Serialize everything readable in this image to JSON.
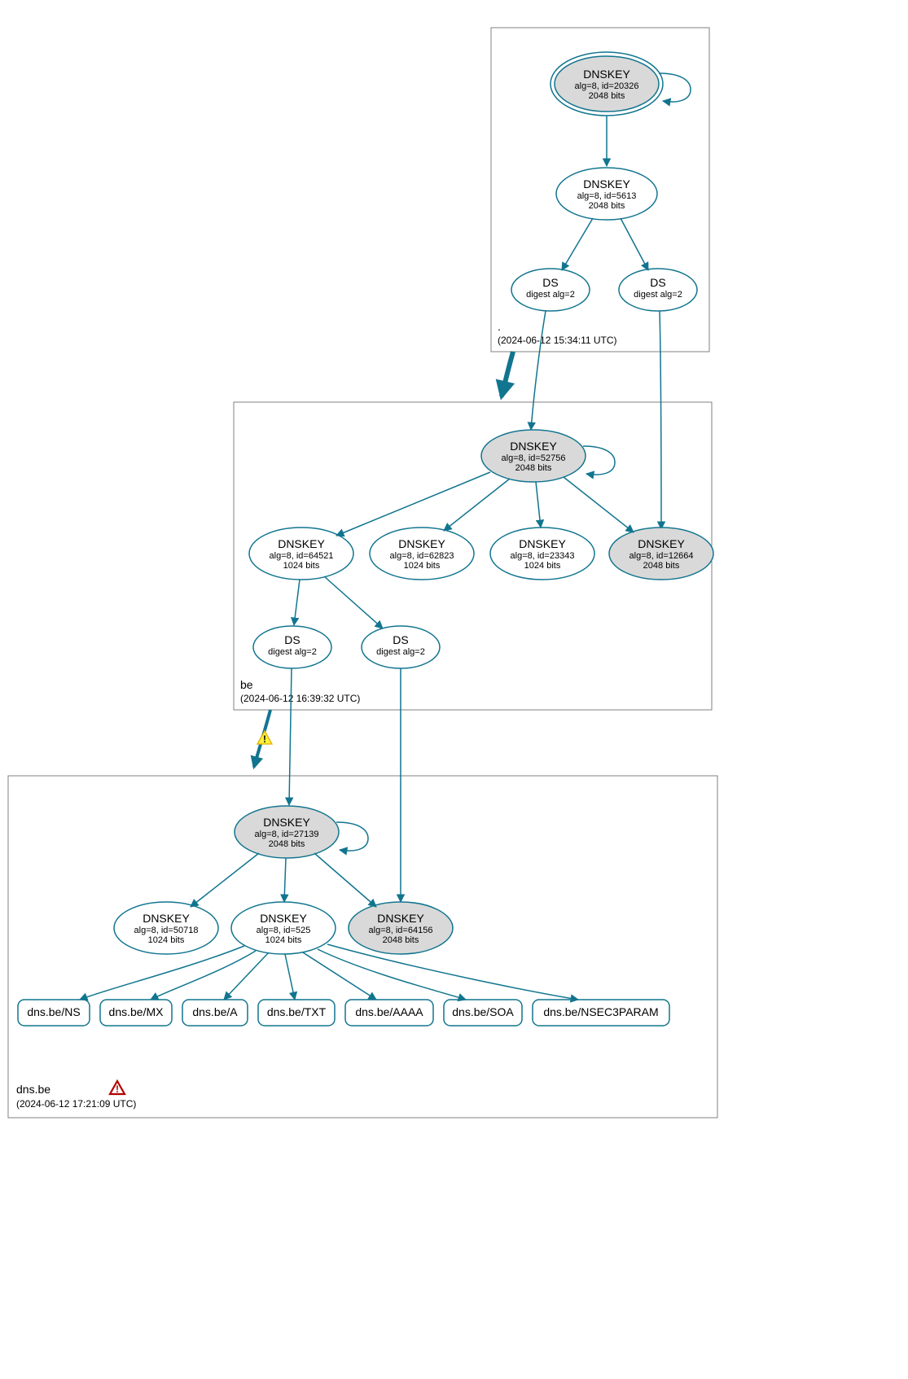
{
  "chart_data": {
    "type": "graph",
    "zones": [
      {
        "id": "root",
        "label": ".",
        "timestamp": "(2024-06-12 15:34:11 UTC)",
        "nodes": [
          {
            "id": "root-ksk",
            "type": "DNSKEY",
            "alg": 8,
            "keyid": 20326,
            "bits": 2048,
            "sep": true,
            "double_ring": true,
            "self_loop": true
          },
          {
            "id": "root-zsk",
            "type": "DNSKEY",
            "alg": 8,
            "keyid": 5613,
            "bits": 2048,
            "sep": false
          },
          {
            "id": "root-ds1",
            "type": "DS",
            "digest_alg": 2
          },
          {
            "id": "root-ds2",
            "type": "DS",
            "digest_alg": 2
          }
        ]
      },
      {
        "id": "be",
        "label": "be",
        "timestamp": "(2024-06-12 16:39:32 UTC)",
        "nodes": [
          {
            "id": "be-ksk",
            "type": "DNSKEY",
            "alg": 8,
            "keyid": 52756,
            "bits": 2048,
            "sep": true,
            "self_loop": true
          },
          {
            "id": "be-zsk1",
            "type": "DNSKEY",
            "alg": 8,
            "keyid": 64521,
            "bits": 1024,
            "sep": false
          },
          {
            "id": "be-zsk2",
            "type": "DNSKEY",
            "alg": 8,
            "keyid": 62823,
            "bits": 1024,
            "sep": false
          },
          {
            "id": "be-zsk3",
            "type": "DNSKEY",
            "alg": 8,
            "keyid": 23343,
            "bits": 1024,
            "sep": false
          },
          {
            "id": "be-key4",
            "type": "DNSKEY",
            "alg": 8,
            "keyid": 12664,
            "bits": 2048,
            "sep": true
          },
          {
            "id": "be-ds1",
            "type": "DS",
            "digest_alg": 2
          },
          {
            "id": "be-ds2",
            "type": "DS",
            "digest_alg": 2
          }
        ]
      },
      {
        "id": "dns.be",
        "label": "dns.be",
        "timestamp": "(2024-06-12 17:21:09 UTC)",
        "has_error_icon": true,
        "nodes": [
          {
            "id": "dnsbe-ksk",
            "type": "DNSKEY",
            "alg": 8,
            "keyid": 27139,
            "bits": 2048,
            "sep": true,
            "self_loop": true
          },
          {
            "id": "dnsbe-zsk1",
            "type": "DNSKEY",
            "alg": 8,
            "keyid": 50718,
            "bits": 1024,
            "sep": false
          },
          {
            "id": "dnsbe-zsk2",
            "type": "DNSKEY",
            "alg": 8,
            "keyid": 525,
            "bits": 1024,
            "sep": false
          },
          {
            "id": "dnsbe-key3",
            "type": "DNSKEY",
            "alg": 8,
            "keyid": 64156,
            "bits": 2048,
            "sep": true
          }
        ],
        "rrsets": [
          "dns.be/NS",
          "dns.be/MX",
          "dns.be/A",
          "dns.be/TXT",
          "dns.be/AAAA",
          "dns.be/SOA",
          "dns.be/NSEC3PARAM"
        ]
      }
    ],
    "edges": [
      {
        "from": "root-ksk",
        "to": "root-zsk"
      },
      {
        "from": "root-zsk",
        "to": "root-ds1"
      },
      {
        "from": "root-zsk",
        "to": "root-ds2"
      },
      {
        "from": "root-ds1",
        "to": "be-ksk"
      },
      {
        "from": "root-ds2",
        "to": "be-key4"
      },
      {
        "from": "root",
        "to": "be",
        "delegation": true,
        "thick": true
      },
      {
        "from": "be-ksk",
        "to": "be-zsk1"
      },
      {
        "from": "be-ksk",
        "to": "be-zsk2"
      },
      {
        "from": "be-ksk",
        "to": "be-zsk3"
      },
      {
        "from": "be-ksk",
        "to": "be-key4"
      },
      {
        "from": "be-zsk1",
        "to": "be-ds1"
      },
      {
        "from": "be-zsk1",
        "to": "be-ds2"
      },
      {
        "from": "be-ds1",
        "to": "dnsbe-ksk"
      },
      {
        "from": "be-ds2",
        "to": "dnsbe-key3"
      },
      {
        "from": "be",
        "to": "dns.be",
        "delegation": true,
        "thick": true,
        "warning": true
      },
      {
        "from": "dnsbe-ksk",
        "to": "dnsbe-zsk1"
      },
      {
        "from": "dnsbe-ksk",
        "to": "dnsbe-zsk2"
      },
      {
        "from": "dnsbe-ksk",
        "to": "dnsbe-key3"
      },
      {
        "from": "dnsbe-zsk2",
        "to": "dns.be/NS"
      },
      {
        "from": "dnsbe-zsk2",
        "to": "dns.be/MX"
      },
      {
        "from": "dnsbe-zsk2",
        "to": "dns.be/A"
      },
      {
        "from": "dnsbe-zsk2",
        "to": "dns.be/TXT"
      },
      {
        "from": "dnsbe-zsk2",
        "to": "dns.be/AAAA"
      },
      {
        "from": "dnsbe-zsk2",
        "to": "dns.be/SOA"
      },
      {
        "from": "dnsbe-zsk2",
        "to": "dns.be/NSEC3PARAM"
      }
    ]
  },
  "labels": {
    "dnskey": "DNSKEY",
    "ds": "DS",
    "alg_prefix": "alg=8, id=",
    "bits_suffix": " bits",
    "digest_prefix": "digest alg="
  }
}
